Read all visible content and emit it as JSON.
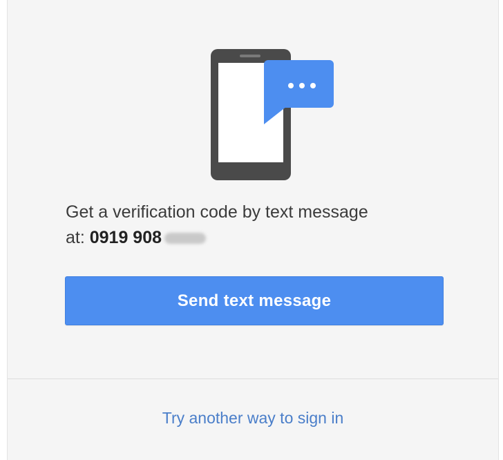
{
  "prompt": {
    "line1": "Get a verification code by text message",
    "prefix": "at: ",
    "phone_visible": "0919 908"
  },
  "actions": {
    "send_label": "Send text message",
    "alternate_label": "Try another way to sign in"
  },
  "icons": {
    "illustration": "phone-with-chat-bubble-icon"
  },
  "colors": {
    "primary_button": "#4d8ef0",
    "link": "#4a7ec9",
    "background": "#f5f5f5",
    "phone_body": "#4a4a4a",
    "chat_bubble": "#4d8ef0"
  }
}
